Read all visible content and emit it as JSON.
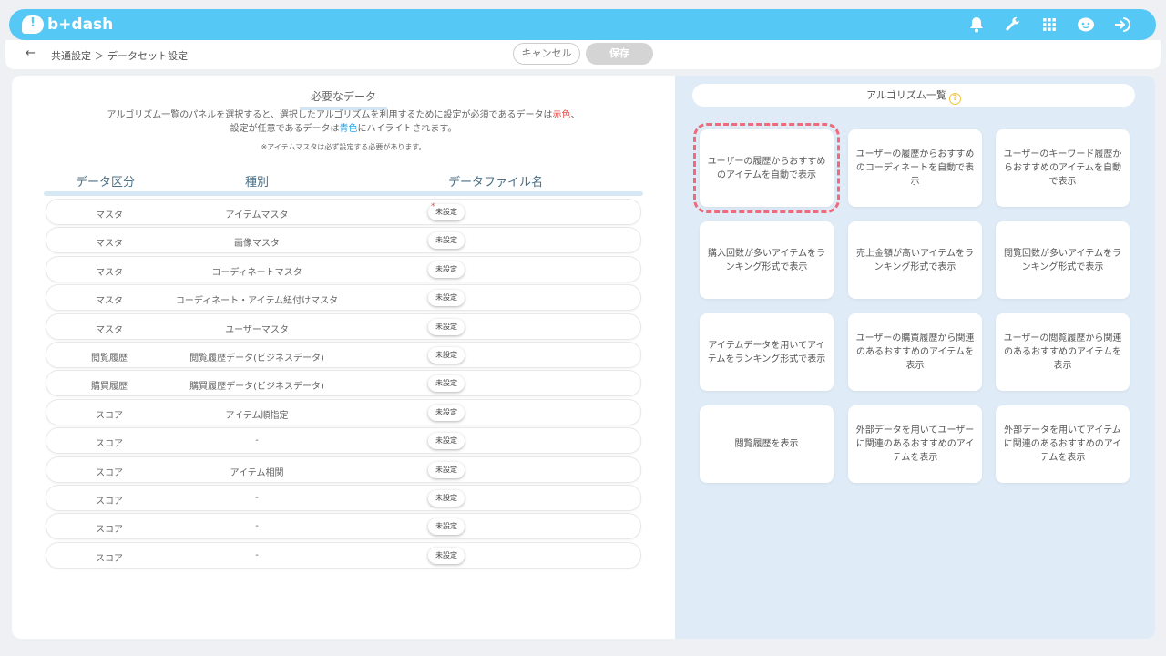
{
  "app": {
    "name": "b+dash"
  },
  "top_icons": [
    "bell-icon",
    "wrench-icon",
    "grid-icon",
    "help-bot-icon",
    "logout-icon"
  ],
  "breadcrumb": {
    "back": "←",
    "text": "共通設定 ＞ データセット設定"
  },
  "actions": {
    "cancel": "キャンセル",
    "save": "保存"
  },
  "required": {
    "title": "必要なデータ",
    "desc_line1_a": "アルゴリズム一覧のパネルを選択すると、選択したアルゴリズムを利用するために設定が必須であるデータは",
    "desc_line1_red": "赤色",
    "desc_line1_b": "、",
    "desc_line2_a": "設定が任意であるデータは",
    "desc_line2_blue": "青色",
    "desc_line2_b": "にハイライトされます。",
    "note": "※アイテムマスタは必ず設定する必要があります。",
    "headers": {
      "category": "データ区分",
      "type": "種別",
      "file": "データファイル名"
    }
  },
  "rows": [
    {
      "category": "マスタ",
      "type": "アイテムマスタ",
      "status": "未設定",
      "required": true
    },
    {
      "category": "マスタ",
      "type": "画像マスタ",
      "status": "未設定"
    },
    {
      "category": "マスタ",
      "type": "コーディネートマスタ",
      "status": "未設定"
    },
    {
      "category": "マスタ",
      "type": "コーディネート・アイテム紐付けマスタ",
      "status": "未設定"
    },
    {
      "category": "マスタ",
      "type": "ユーザーマスタ",
      "status": "未設定"
    },
    {
      "category": "閲覧履歴",
      "type": "閲覧履歴データ(ビジネスデータ)",
      "status": "未設定"
    },
    {
      "category": "購買履歴",
      "type": "購買履歴データ(ビジネスデータ)",
      "status": "未設定"
    },
    {
      "category": "スコア",
      "type": "アイテム順指定",
      "status": "未設定"
    },
    {
      "category": "スコア",
      "type": "-",
      "status": "未設定"
    },
    {
      "category": "スコア",
      "type": "アイテム相関",
      "status": "未設定"
    },
    {
      "category": "スコア",
      "type": "-",
      "status": "未設定"
    },
    {
      "category": "スコア",
      "type": "-",
      "status": "未設定"
    },
    {
      "category": "スコア",
      "type": "-",
      "status": "未設定"
    }
  ],
  "algorithms": {
    "title": "アルゴリズム一覧",
    "help": "?",
    "cards": [
      {
        "label": "ユーザーの履歴からおすすめのアイテムを自動で表示",
        "selected": true
      },
      {
        "label": "ユーザーの履歴からおすすめのコーディネートを自動で表示"
      },
      {
        "label": "ユーザーのキーワード履歴からおすすめのアイテムを自動で表示"
      },
      {
        "label": "購入回数が多いアイテムをランキング形式で表示"
      },
      {
        "label": "売上金額が高いアイテムをランキング形式で表示"
      },
      {
        "label": "閲覧回数が多いアイテムをランキング形式で表示"
      },
      {
        "label": "アイテムデータを用いてアイテムをランキング形式で表示"
      },
      {
        "label": "ユーザーの購買履歴から関連のあるおすすめのアイテムを表示"
      },
      {
        "label": "ユーザーの閲覧履歴から関連のあるおすすめのアイテムを表示"
      },
      {
        "label": "閲覧履歴を表示"
      },
      {
        "label": "外部データを用いてユーザーに関連のあるおすすめのアイテムを表示"
      },
      {
        "label": "外部データを用いてアイテムに関連のあるおすすめのアイテムを表示"
      }
    ]
  },
  "colors": {
    "accent": "#55c8f5",
    "required": "#e84f4f",
    "optional": "#29a3e6",
    "selected_outline": "#ef6b7b"
  }
}
